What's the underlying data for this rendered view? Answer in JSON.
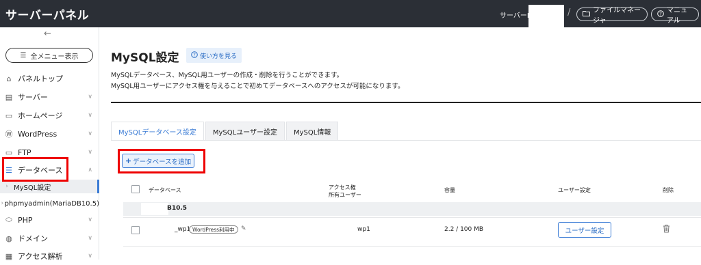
{
  "topbar": {
    "brand": "サーバーパネル",
    "server_id_label": "サーバーID",
    "separator": "/",
    "file_manager": "ファイルマネージャ",
    "manual": "マニュアル"
  },
  "sidebar": {
    "collapse_icon": "arrow-left-icon",
    "all_menu": "全メニュー表示",
    "items": [
      {
        "label": "パネルトップ",
        "icon": "home-icon"
      },
      {
        "label": "サーバー",
        "icon": "server-icon"
      },
      {
        "label": "ホームページ",
        "icon": "window-icon"
      },
      {
        "label": "WordPress",
        "icon": "wordpress-icon"
      },
      {
        "label": "FTP",
        "icon": "monitor-icon"
      },
      {
        "label": "データベース",
        "icon": "database-icon"
      },
      {
        "label": "MySQL設定"
      },
      {
        "label": "phpmyadmin(MariaDB10.5)"
      },
      {
        "label": "PHP",
        "icon": "php-icon"
      },
      {
        "label": "ドメイン",
        "icon": "globe-icon"
      },
      {
        "label": "アクセス解析",
        "icon": "chart-icon"
      }
    ]
  },
  "main": {
    "title": "MySQL設定",
    "howto": "使い方を見る",
    "desc1": "MySQLデータベース、MySQL用ユーザーの作成・削除を行うことができます。",
    "desc2": "MySQL用ユーザーにアクセス権を与えることで初めてデータベースへのアクセスが可能になります。",
    "tabs": [
      "MySQLデータベース設定",
      "MySQLユーザー設定",
      "MySQL情報"
    ],
    "add_button": "データベースを追加",
    "table": {
      "headers": {
        "database": "データベース",
        "access_1": "アクセス権",
        "access_2": "所有ユーザー",
        "capacity": "容量",
        "user_settings": "ユーザー設定",
        "delete": "削除"
      },
      "group_label": "B10.5",
      "row": {
        "db_name": "_wp1",
        "badge": "WordPress利用中",
        "owner": "wp1",
        "capacity": "2.2 / 100 MB",
        "user_button": "ユーザー設定"
      }
    }
  },
  "colors": {
    "accent": "#3a7bd5",
    "highlight": "#ee0000",
    "topbar": "#2b2f36"
  }
}
